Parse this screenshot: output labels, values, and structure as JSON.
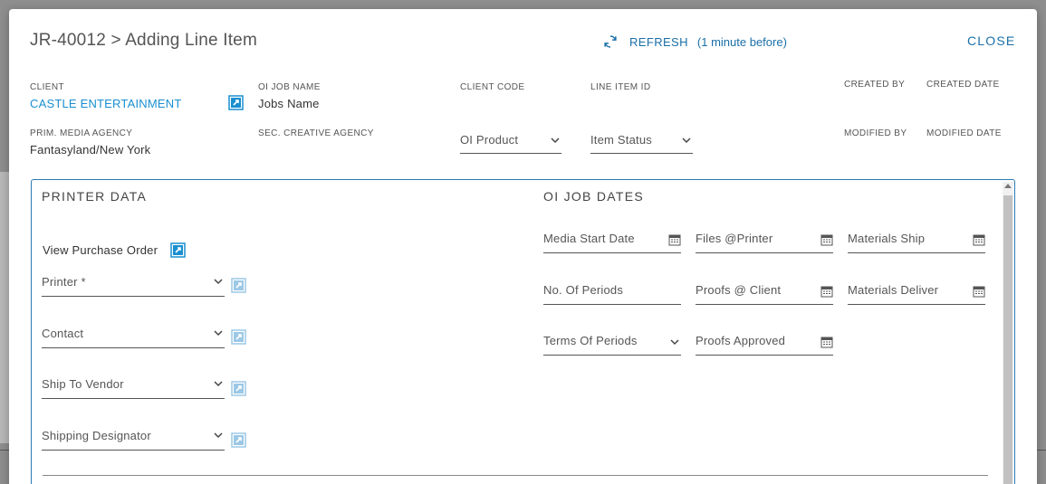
{
  "header": {
    "title": "JR-40012 > Adding Line Item",
    "refresh_label": "REFRESH",
    "refresh_time": "(1 minute before)",
    "close_label": "CLOSE"
  },
  "fields": {
    "client_label": "CLIENT",
    "client_value": "CASTLE ENTERTAINMENT",
    "oi_job_name_label": "OI JOB NAME",
    "oi_job_name_value": "Jobs Name",
    "client_code_label": "CLIENT CODE",
    "line_item_id_label": "LINE ITEM ID",
    "created_by_label": "CREATED BY",
    "created_date_label": "CREATED DATE",
    "prim_media_agency_label": "PRIM. MEDIA AGENCY",
    "prim_media_agency_value": "Fantasyland/New York",
    "sec_creative_agency_label": "SEC. CREATIVE AGENCY",
    "oi_product_placeholder": "OI Product",
    "item_status_placeholder": "Item Status",
    "modified_by_label": "MODIFIED BY",
    "modified_date_label": "MODIFIED DATE"
  },
  "printer_data": {
    "title": "PRINTER DATA",
    "view_po_label": "View Purchase Order",
    "printer_placeholder": "Printer *",
    "contact_placeholder": "Contact",
    "ship_to_vendor_placeholder": "Ship To Vendor",
    "shipping_designator_placeholder": "Shipping Designator"
  },
  "oi_job_dates": {
    "title": "OI JOB DATES",
    "media_start_date": "Media Start Date",
    "files_printer": "Files @Printer",
    "materials_ship": "Materials Ship",
    "no_of_periods": "No. Of Periods",
    "proofs_client": "Proofs @ Client",
    "materials_deliver": "Materials Deliver",
    "terms_of_periods": "Terms Of Periods",
    "proofs_approved": "Proofs Approved"
  },
  "colors": {
    "accent": "#1a6fa8",
    "link": "#1a8fd0",
    "section_border": "#2a7bb0"
  },
  "icons": {
    "refresh": "refresh-icon",
    "external_link": "external-link-icon",
    "calendar": "calendar-icon",
    "caret": "chevron-down-icon"
  }
}
